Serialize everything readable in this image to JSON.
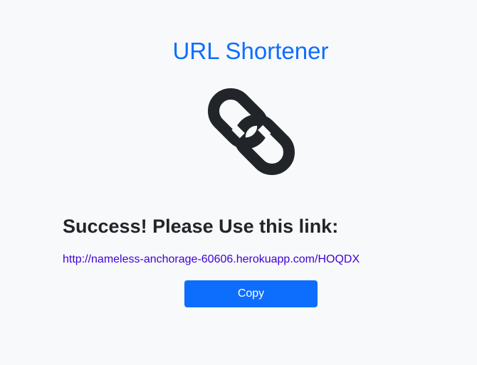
{
  "header": {
    "title": "URL Shortener"
  },
  "logo": {
    "icon": "link-icon",
    "color": "#212529"
  },
  "result": {
    "message": "Success! Please Use this link:",
    "link_text": "http://nameless-anchorage-60606.herokuapp.com/HOQDX",
    "copy_label": "Copy"
  },
  "colors": {
    "accent": "#0d6efd",
    "link": "#3f00d6",
    "background": "#f8f9fa",
    "text": "#212529"
  }
}
